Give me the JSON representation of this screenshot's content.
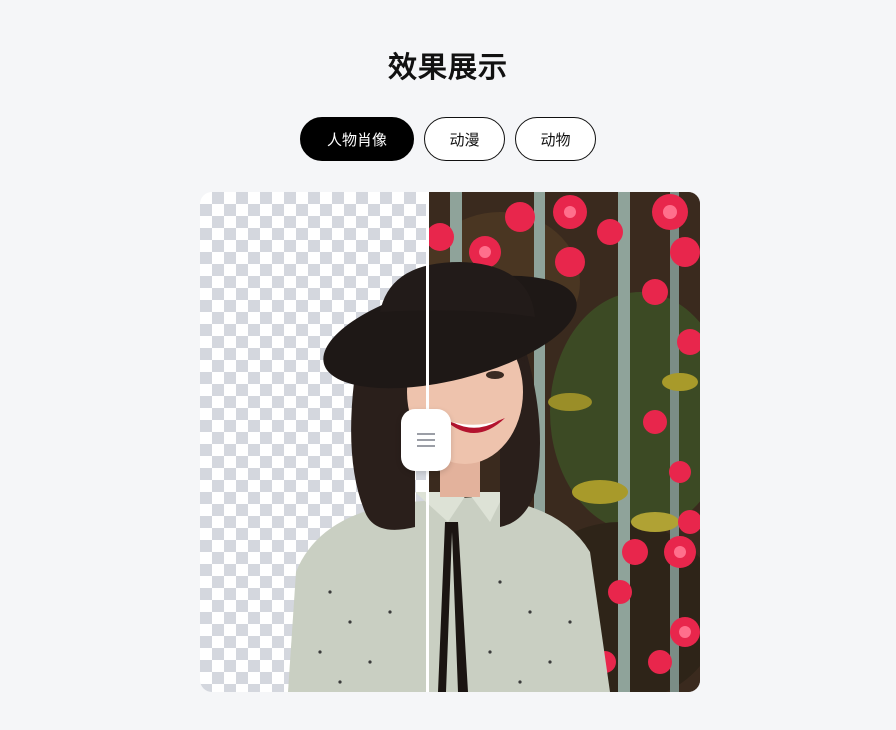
{
  "section": {
    "title": "效果展示"
  },
  "tabs": [
    {
      "label": "人物肖像",
      "active": true
    },
    {
      "label": "动漫",
      "active": false
    },
    {
      "label": "动物",
      "active": false
    }
  ],
  "compare": {
    "left_label": "",
    "right_label": "",
    "slider_position": 0.455,
    "handle_icon": "menu-lines-icon"
  },
  "colors": {
    "active_tab_bg": "#000000",
    "page_bg": "#f5f6f8",
    "checker": "#d4d7de",
    "flower": "#e8264c"
  }
}
